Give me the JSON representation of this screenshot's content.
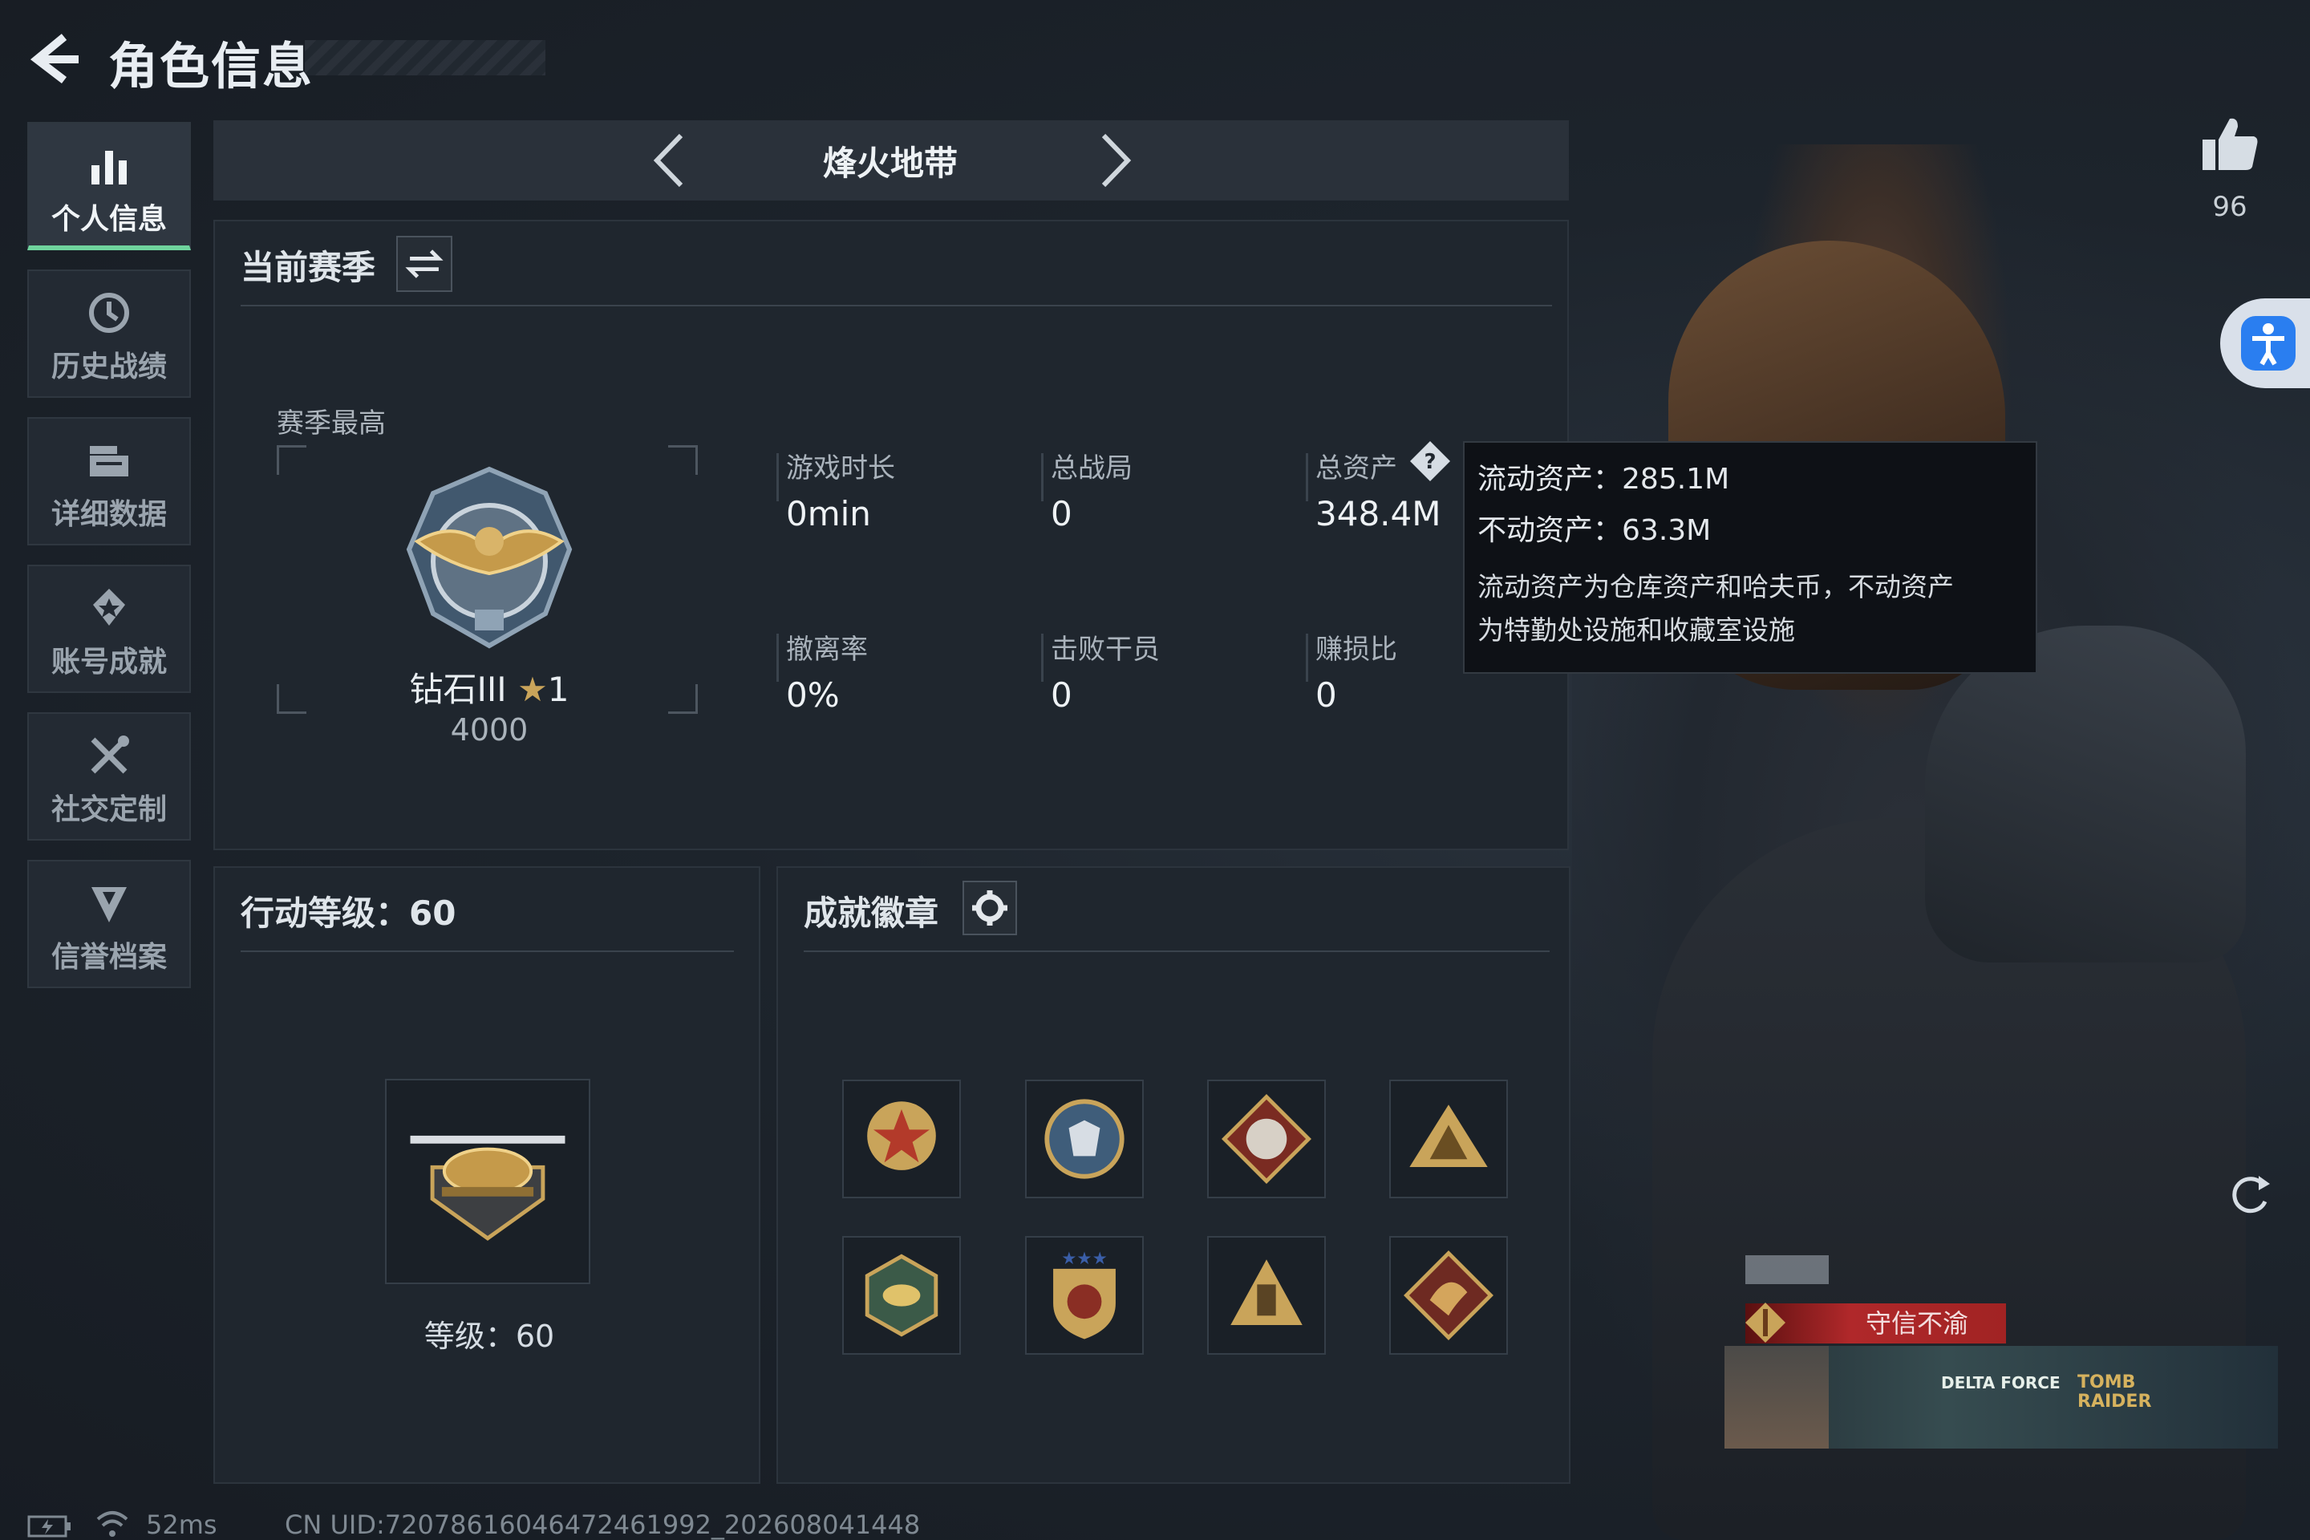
{
  "header": {
    "title": "角色信息",
    "back_icon": "back-arrow-icon"
  },
  "sidebar": {
    "items": [
      {
        "label": "个人信息",
        "icon": "bar-chart-icon",
        "active": true
      },
      {
        "label": "历史战绩",
        "icon": "history-clock-icon",
        "active": false
      },
      {
        "label": "详细数据",
        "icon": "folder-data-icon",
        "active": false
      },
      {
        "label": "账号成就",
        "icon": "achievement-star-icon",
        "active": false
      },
      {
        "label": "社交定制",
        "icon": "tools-icon",
        "active": false
      },
      {
        "label": "信誉档案",
        "icon": "shield-badge-icon",
        "active": false
      }
    ]
  },
  "mode": {
    "title": "烽火地带"
  },
  "season": {
    "title": "当前赛季",
    "best_label": "赛季最高",
    "rank_name": "钻石III",
    "rank_stars": "1",
    "rank_score": "4000",
    "stats": [
      {
        "label": "游戏时长",
        "value": "0min"
      },
      {
        "label": "总战局",
        "value": "0"
      },
      {
        "label": "总资产",
        "value": "348.4M"
      },
      {
        "label": "撤离率",
        "value": "0%"
      },
      {
        "label": "击败干员",
        "value": "0"
      },
      {
        "label": "赚损比",
        "value": "0"
      }
    ]
  },
  "tooltip": {
    "liquid_label": "流动资产：",
    "liquid_value": "285.1M",
    "fixed_label": "不动资产：",
    "fixed_value": "63.3M",
    "desc_line1": "流动资产为仓库资产和哈夫币，不动资产",
    "desc_line2": "为特勤处设施和收藏室设施"
  },
  "action": {
    "title": "行动等级：60",
    "level_label": "等级：60"
  },
  "achievements": {
    "title": "成就徽章",
    "medals": [
      "star-medal-icon",
      "wolf-round-medal-icon",
      "beast-diamond-medal-icon",
      "pyramid-medal-icon",
      "wasp-hex-medal-icon",
      "shield-star-medal-icon",
      "tower-medal-icon",
      "dragon-diamond-medal-icon"
    ]
  },
  "social": {
    "likes": "96",
    "badge_title": "守信不渝",
    "banner_left": "DELTA FORCE",
    "banner_right_1": "TOMB",
    "banner_right_2": "RAIDER"
  },
  "status": {
    "ping": "52ms",
    "uid": "CN UID:72078616046472461992_202608041448"
  },
  "colors": {
    "active_accent": "#6fd39d",
    "tooltip_bg": "#0e1116",
    "badge_red": "#b0282a"
  }
}
